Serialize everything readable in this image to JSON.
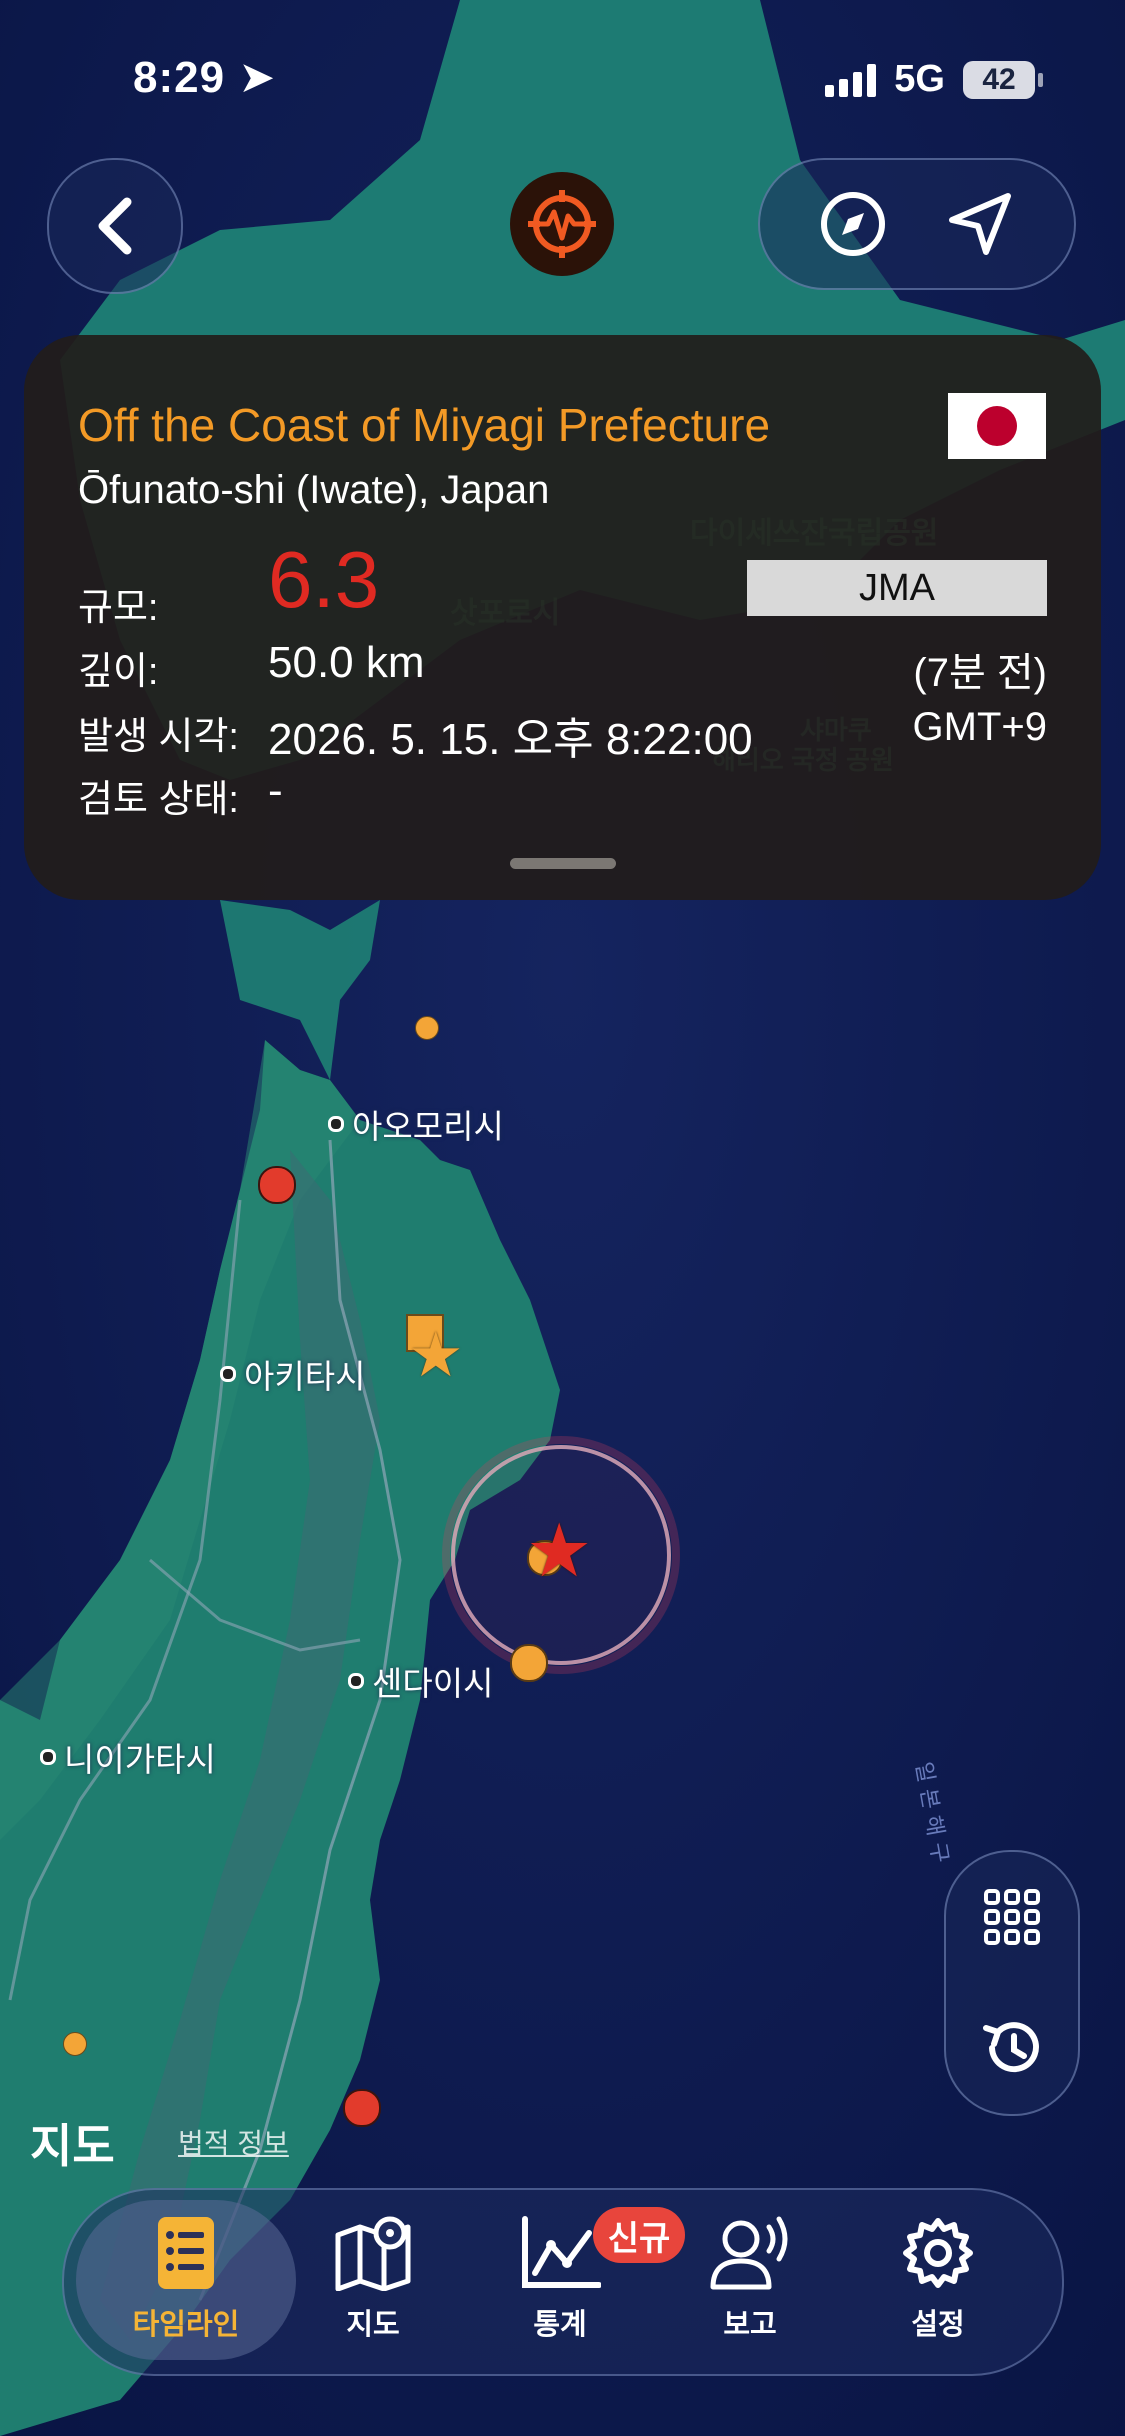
{
  "status_bar": {
    "time": "8:29",
    "network": "5G",
    "battery": "42"
  },
  "quake": {
    "title": "Off the Coast of Miyagi Prefecture",
    "location": "Ōfunato-shi (Iwate), Japan",
    "magnitude_label": "규모:",
    "magnitude": "6.3",
    "agency": "JMA",
    "depth_label": "깊이:",
    "depth": "50.0 km",
    "ago": "(7분 전)",
    "time_label": "발생 시각:",
    "time": "2026. 5. 15. 오후 8:22:00",
    "tz": "GMT+9",
    "review_label": "검토 상태:",
    "review": "-"
  },
  "map": {
    "cities": {
      "aomori": "아오모리시",
      "akita": "아키타시",
      "sendai": "센다이시",
      "niigata": "니이가타시"
    },
    "background_labels": {
      "sapporo": "삿포로시",
      "park1": "다이세쓰잔국립공원",
      "park2a": "샤마쿠",
      "park2b": "해리오 국정 공원"
    },
    "attribution": {
      "brand": "지도",
      "legal": "법적 정보"
    }
  },
  "tabs": [
    {
      "label": "타임라인",
      "icon": "timeline-icon",
      "active": true
    },
    {
      "label": "지도",
      "icon": "map-icon"
    },
    {
      "label": "통계",
      "icon": "chart-icon",
      "badge": "신규"
    },
    {
      "label": "보고",
      "icon": "report-icon"
    },
    {
      "label": "설정",
      "icon": "gear-icon"
    }
  ],
  "colors": {
    "accent": "#f39a26",
    "magnitude": "#e02a22",
    "active_tab": "#f5b436",
    "badge": "#e8453c"
  }
}
